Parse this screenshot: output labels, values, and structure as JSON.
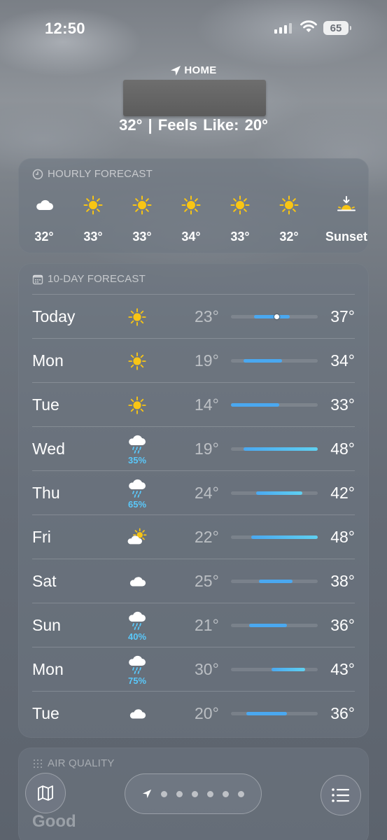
{
  "status_bar": {
    "time": "12:50",
    "battery": "65"
  },
  "header": {
    "location_label": "HOME",
    "temp_line": "32°  |  Feels Like: 20°"
  },
  "hourly": {
    "title": "HOURLY FORECAST",
    "items": [
      {
        "icon": "cloud-icon",
        "temp": "32°"
      },
      {
        "icon": "sun-icon",
        "temp": "33°"
      },
      {
        "icon": "sun-icon",
        "temp": "33°"
      },
      {
        "icon": "sun-icon",
        "temp": "34°"
      },
      {
        "icon": "sun-icon",
        "temp": "33°"
      },
      {
        "icon": "sun-icon",
        "temp": "32°"
      },
      {
        "icon": "sunset-icon",
        "temp": "Sunset"
      }
    ]
  },
  "tenday": {
    "title": "10-DAY FORECAST",
    "range_scale": {
      "min": 14,
      "max": 48
    },
    "current_temp": 32,
    "days": [
      {
        "day": "Today",
        "icon": "sun-icon",
        "precip": "",
        "low": "23°",
        "high": "37°",
        "lo": 23,
        "hi": 37
      },
      {
        "day": "Mon",
        "icon": "sun-icon",
        "precip": "",
        "low": "19°",
        "high": "34°",
        "lo": 19,
        "hi": 34
      },
      {
        "day": "Tue",
        "icon": "sun-icon",
        "precip": "",
        "low": "14°",
        "high": "33°",
        "lo": 14,
        "hi": 33
      },
      {
        "day": "Wed",
        "icon": "rain-cloud-icon",
        "precip": "35%",
        "low": "19°",
        "high": "48°",
        "lo": 19,
        "hi": 48
      },
      {
        "day": "Thu",
        "icon": "rain-cloud-icon",
        "precip": "65%",
        "low": "24°",
        "high": "42°",
        "lo": 24,
        "hi": 42
      },
      {
        "day": "Fri",
        "icon": "partly-cloudy-icon",
        "precip": "",
        "low": "22°",
        "high": "48°",
        "lo": 22,
        "hi": 48
      },
      {
        "day": "Sat",
        "icon": "cloud-icon",
        "precip": "",
        "low": "25°",
        "high": "38°",
        "lo": 25,
        "hi": 38
      },
      {
        "day": "Sun",
        "icon": "rain-cloud-icon",
        "precip": "40%",
        "low": "21°",
        "high": "36°",
        "lo": 21,
        "hi": 36
      },
      {
        "day": "Mon",
        "icon": "rain-cloud-icon",
        "precip": "75%",
        "low": "30°",
        "high": "43°",
        "lo": 30,
        "hi": 43
      },
      {
        "day": "Tue",
        "icon": "cloud-icon",
        "precip": "",
        "low": "20°",
        "high": "36°",
        "lo": 20,
        "hi": 36
      }
    ]
  },
  "air_quality": {
    "title": "AIR QUALITY",
    "value": "Good"
  },
  "colors": {
    "sun": "#f8c514",
    "precip": "#5ac8fa",
    "bar_cool": "#4aa8f0",
    "bar_mild": "#5fd0f0"
  }
}
